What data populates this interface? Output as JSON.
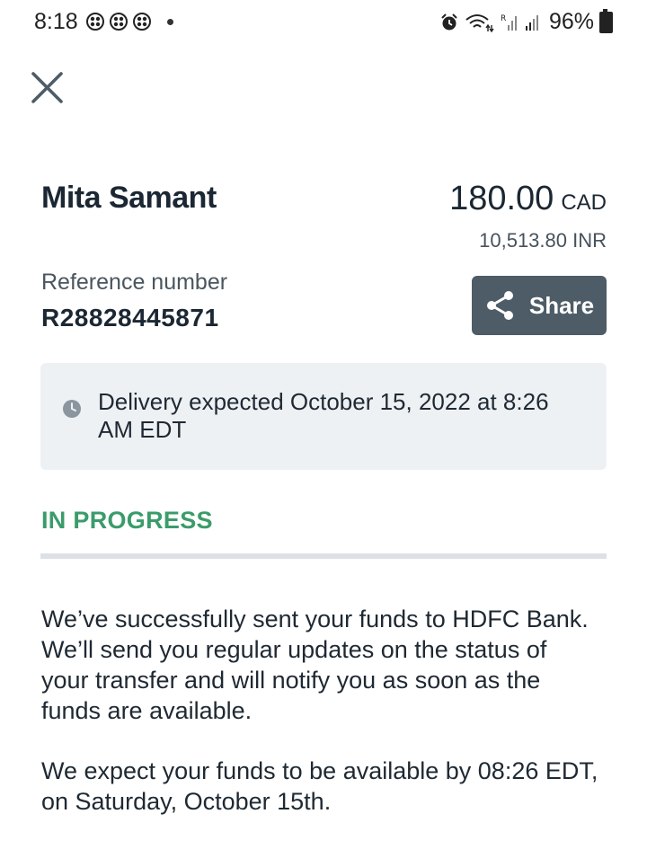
{
  "status_bar": {
    "time": "8:18",
    "battery": "96%",
    "icons": [
      "notification-icon",
      "notification-icon",
      "notification-icon",
      "alarm-icon",
      "wifi-icon",
      "signal-icon"
    ]
  },
  "header": {
    "close_icon": "close-icon"
  },
  "transfer": {
    "recipient": "Mita Samant",
    "amount": "180.00",
    "currency": "CAD",
    "converted": "10,513.80 INR",
    "reference_label": "Reference number",
    "reference_value": "R28828445871",
    "share_label": "Share",
    "delivery_text": "Delivery expected October 15, 2022 at 8:26 AM EDT",
    "status": "IN PROGRESS",
    "progress": 0,
    "message_1": "We’ve successfully sent your funds to HDFC Bank. We’ll send you regular updates on the status of your transfer and will notify you as soon as the funds are available.",
    "message_2": "We expect your funds to be available by 08:26 EDT, on Saturday, October 15th."
  },
  "colors": {
    "accent_green": "#3a9c6a",
    "share_button": "#4d5c66",
    "info_box": "#eef1f4"
  }
}
